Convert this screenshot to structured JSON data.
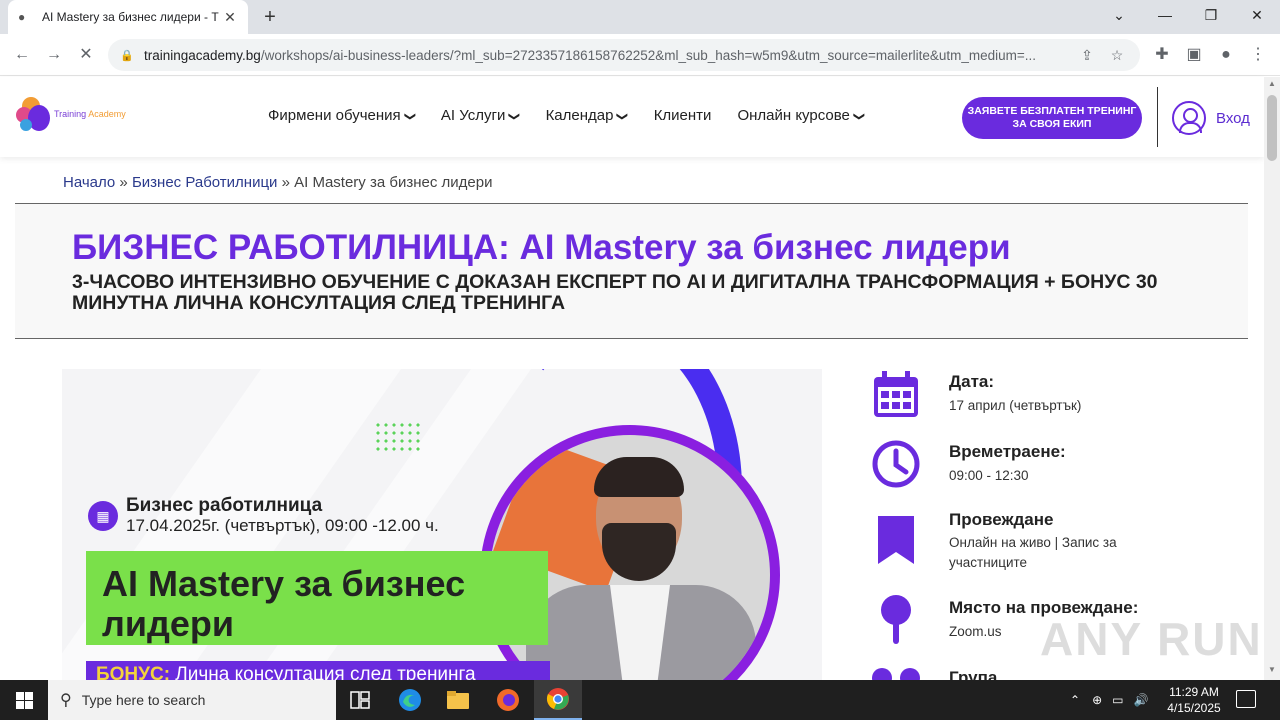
{
  "browser": {
    "tab_title": "AI Mastery за бизнес лидери - T",
    "url_domain": "trainingacademy.bg",
    "url_path": "/workshops/ai-business-leaders/?ml_sub=2723357186158762252&ml_sub_hash=w5m9&utm_source=mailerlite&utm_medium=..."
  },
  "header": {
    "logo_text_1": "Training ",
    "logo_text_2": "Academy",
    "nav": [
      {
        "label": "Фирмени обучения",
        "dropdown": true
      },
      {
        "label": "AI Услуги",
        "dropdown": true
      },
      {
        "label": "Календар",
        "dropdown": true
      },
      {
        "label": "Клиенти",
        "dropdown": false
      },
      {
        "label": "Онлайн курсове",
        "dropdown": true
      }
    ],
    "cta_label": "ЗАЯВЕТЕ БЕЗПЛАТЕН ТРЕНИНГ ЗА СВОЯ ЕКИП",
    "login_label": "Вход"
  },
  "breadcrumb": {
    "home": "Начало",
    "sep": " » ",
    "section": "Бизнес Работилници",
    "current": "AI Mastery за бизнес лидери"
  },
  "page": {
    "title": "БИЗНЕС РАБОТИЛНИЦА: AI Mastery за бизнес лидери",
    "subtitle": "3-ЧАСОВО ИНТЕНЗИВНО ОБУЧЕНИЕ С ДОКАЗАН ЕКСПЕРТ ПО AI И ДИГИТАЛНА ТРАНСФОРМАЦИЯ + БОНУС 30 МИНУТНА ЛИЧНА КОНСУЛТАЦИЯ СЛЕД ТРЕНИНГА"
  },
  "banner": {
    "label": "Бизнес работилница",
    "date": "17.04.2025г. (четвъртък), 09:00 -12.00 ч.",
    "title_line1": "AI Mastery за бизнес",
    "title_line2": "лидери",
    "bonus_label": "БОНУС:",
    "bonus_text": " Лична консултация след тренинга"
  },
  "info": {
    "date_label": "Дата:",
    "date_value": "17 април (четвъртък)",
    "duration_label": "Времетраене:",
    "duration_value": "09:00 - 12:30",
    "format_label": "Провеждане",
    "format_value": "Онлайн на живо | Запис за участниците",
    "place_label": "Място на провеждане:",
    "place_value": "Zoom.us",
    "group_label": "Група"
  },
  "taskbar": {
    "search_placeholder": "Type here to search",
    "time": "11:29 AM",
    "date": "4/15/2025"
  },
  "watermark": "ANY RUN",
  "colors": {
    "brand_purple": "#6a2bde",
    "banner_green": "#7ae04a"
  }
}
